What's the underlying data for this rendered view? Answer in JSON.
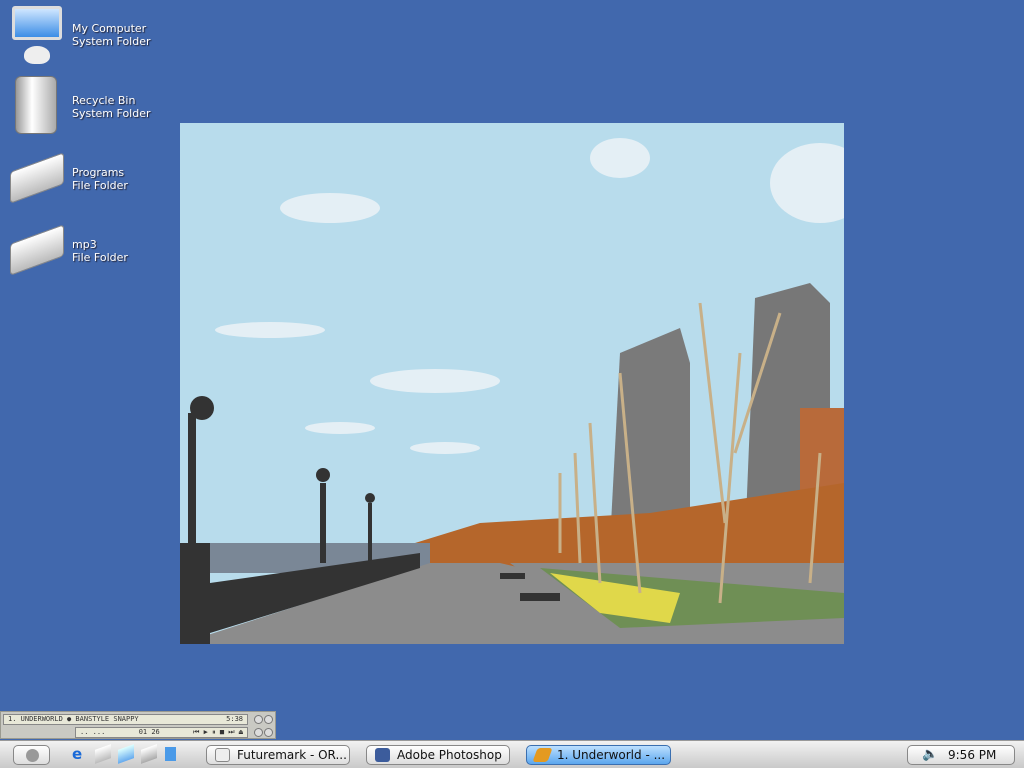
{
  "desktop": {
    "icons": [
      {
        "name": "My Computer",
        "type": "System Folder"
      },
      {
        "name": "Recycle Bin",
        "type": "System Folder"
      },
      {
        "name": "Programs",
        "type": "File Folder"
      },
      {
        "name": "mp3",
        "type": "File Folder"
      }
    ]
  },
  "winamp": {
    "track": "1. UNDERWORLD ● BANSTYLE SNAPPY",
    "duration": "5:38",
    "elapsed": "01 26",
    "indicator": "..    ...",
    "controls": "⏮ ▶ ⏸ ■ ⏭ ⏏"
  },
  "taskbar": {
    "tasks": [
      {
        "label": "Futuremark - OR...",
        "active": false
      },
      {
        "label": "Adobe Photoshop",
        "active": false
      },
      {
        "label": "1. Underworld - ...",
        "active": true
      }
    ],
    "clock": "9:56 PM",
    "volume_icon": "speaker-icon"
  }
}
